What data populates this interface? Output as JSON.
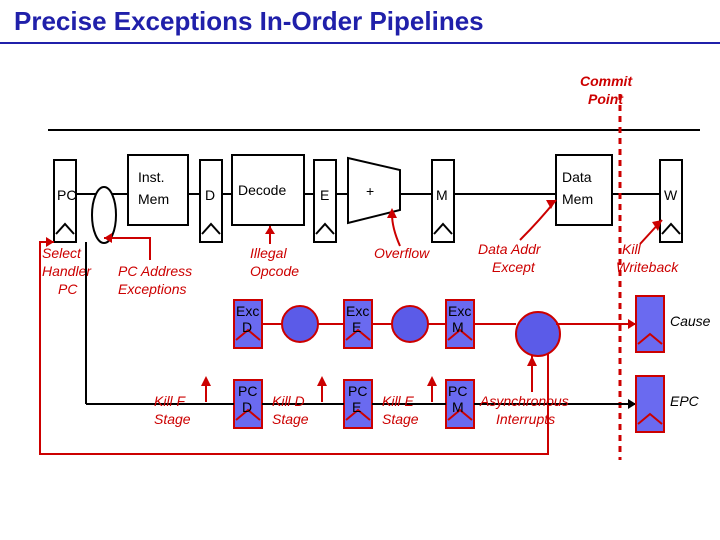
{
  "title": "Precise Exceptions In-Order Pipelines",
  "commit": {
    "l1": "Commit",
    "l2": "Point"
  },
  "stages": {
    "pc": "PC",
    "inst1": "Inst.",
    "inst2": "Mem",
    "d": "D",
    "decode": "Decode",
    "e": "E",
    "plus": "+",
    "m": "M",
    "data1": "Data",
    "data2": "Mem",
    "w": "W"
  },
  "ann": {
    "sel1": "Select",
    "sel2": "Handler",
    "sel3": "PC",
    "pca1": "PC Address",
    "pca2": "Exceptions",
    "ill1": "Illegal",
    "ill2": "Opcode",
    "ov": "Overflow",
    "dae1": "Data Addr",
    "dae2": "Except",
    "kw1": "Kill",
    "kw2": "Writeback",
    "kf1": "Kill F",
    "kf2": "Stage",
    "kd1": "Kill D",
    "kd2": "Stage",
    "ke1": "Kill E",
    "ke2": "Stage",
    "ai1": "Asynchronous",
    "ai2": "Interrupts"
  },
  "excreg": {
    "excD1": "Exc",
    "excD2": "D",
    "excE1": "Exc",
    "excE2": "E",
    "excM1": "Exc",
    "excM2": "M"
  },
  "pcreg": {
    "pcD1": "PC",
    "pcD2": "D",
    "pcE1": "PC",
    "pcE2": "E",
    "pcM1": "PC",
    "pcM2": "M"
  },
  "out": {
    "cause": "Cause",
    "epc": "EPC"
  }
}
